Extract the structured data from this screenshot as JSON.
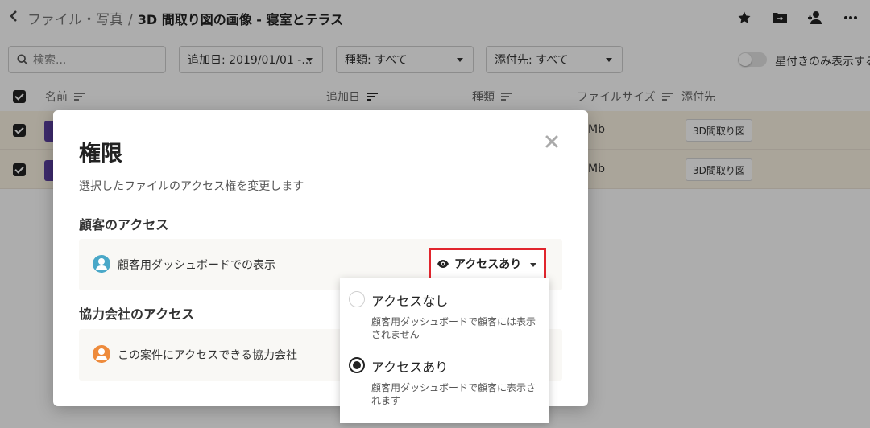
{
  "header": {
    "back_icon": "chevron-left-icon",
    "breadcrumb_parent": "ファイル・写真",
    "breadcrumb_sep": "/",
    "breadcrumb_current": "3D 間取り図の画像 - 寝室とテラス",
    "icons": [
      "star-icon",
      "move-folder-icon",
      "share-user-icon",
      "more-icon"
    ]
  },
  "filters": {
    "search_placeholder": "検索...",
    "date_filter": "追加日: 2019/01/01 -...",
    "type_filter": "種類: すべて",
    "attach_filter": "添付先: すべて",
    "starred_only_label": "星付きのみ表示する"
  },
  "table": {
    "columns": [
      "名前",
      "追加日",
      "種類",
      "ファイルサイズ",
      "添付先"
    ],
    "rows": [
      {
        "size": "Mb",
        "attached": "3D間取り図"
      },
      {
        "size": "Mb",
        "attached": "3D間取り図"
      }
    ]
  },
  "modal": {
    "title": "権限",
    "subtitle": "選択したファイルのアクセス権を変更します",
    "client_section_title": "顧客のアクセス",
    "client_row_label": "顧客用ダッシュボードでの表示",
    "partner_section_title": "協力会社のアクセス",
    "partner_row_label": "この案件にアクセスできる協力会社",
    "access_value": "アクセスあり"
  },
  "access_menu": {
    "options": [
      {
        "label": "アクセスなし",
        "description": "顧客用ダッシュボードで顧客には表示されません",
        "selected": false
      },
      {
        "label": "アクセスあり",
        "description": "顧客用ダッシュボードで顧客に表示されます",
        "selected": true
      }
    ]
  },
  "colors": {
    "highlight": "#e1252d",
    "row_selected": "#fbf3e4",
    "client_avatar": "#4aa8c8",
    "partner_avatar": "#ee8b3c"
  }
}
